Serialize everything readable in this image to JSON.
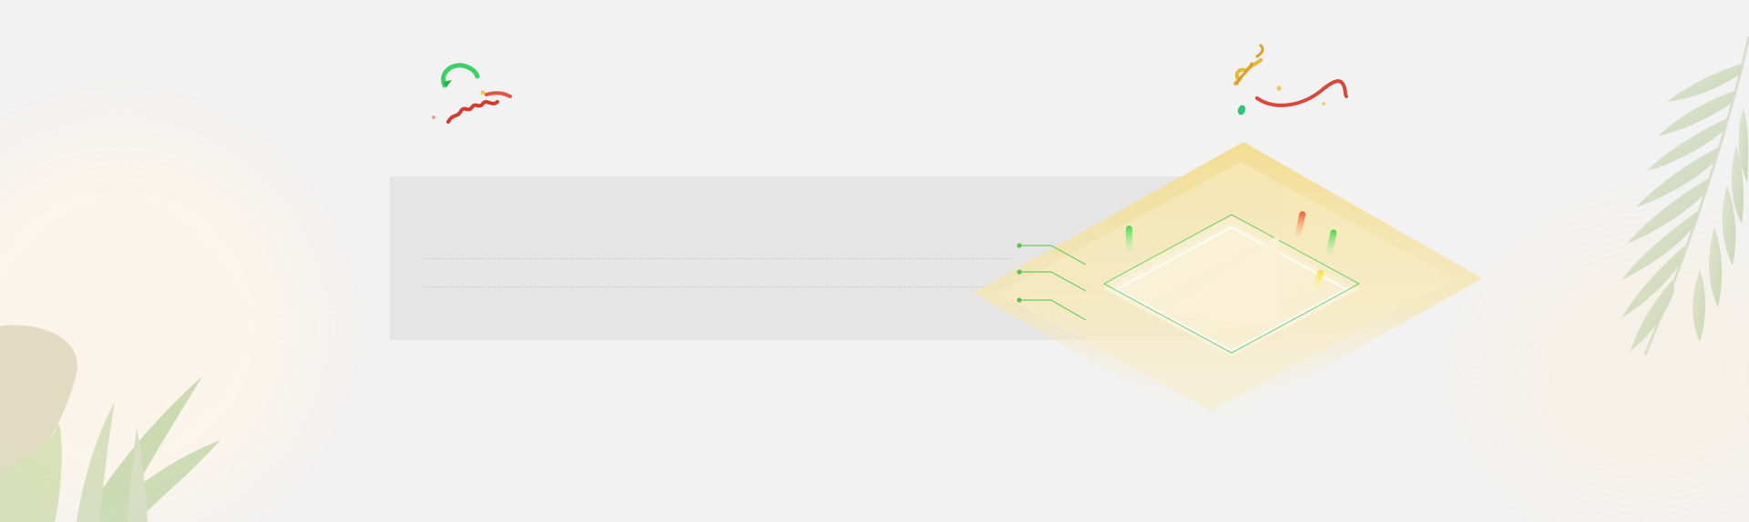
{
  "panel": {
    "lines": 2
  },
  "decorations": {
    "accent_yellow": "#f0d88a",
    "accent_green": "#5ccc55",
    "accent_red": "#d8423b",
    "leaf_green": "#9ec27a"
  }
}
